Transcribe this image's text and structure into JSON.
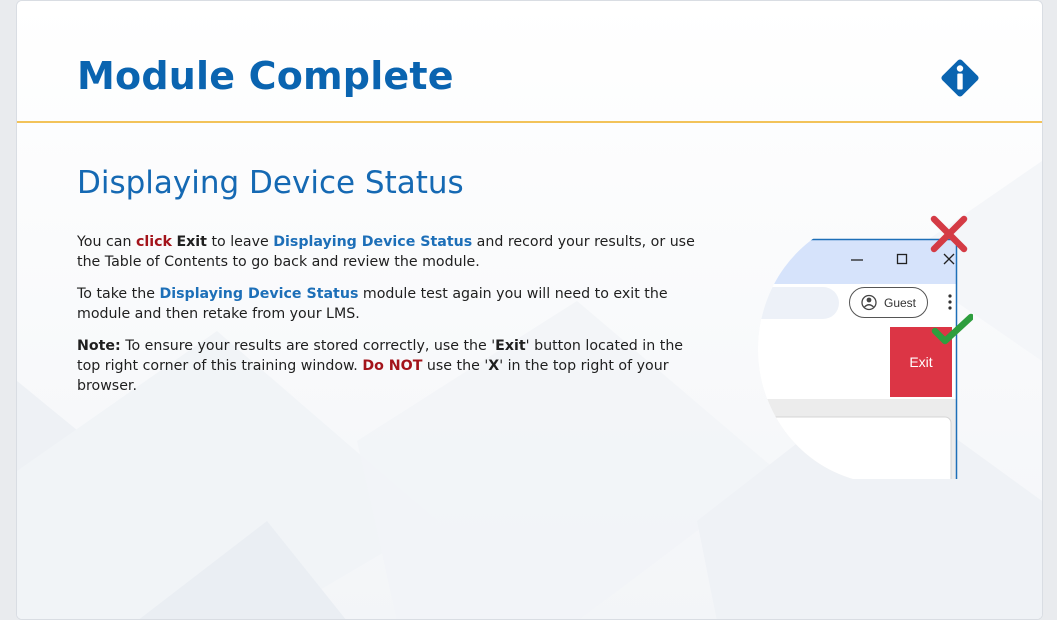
{
  "header": {
    "title": "Module Complete",
    "info_icon": "info-diamond-icon"
  },
  "main": {
    "subtitle": "Displaying Device Status",
    "p1": {
      "t1": "You can ",
      "click": "click",
      "t2": " ",
      "exit": "Exit",
      "t3": " to leave ",
      "module": "Displaying Device Status",
      "t4": " and record your results, or use the Table of Contents to go back and review the module."
    },
    "p2": {
      "t1": "To take the ",
      "module": "Displaying Device Status",
      "t2": " module test again you will need to exit the module and then retake from your LMS."
    },
    "p3": {
      "note": "Note:",
      "t1": " To ensure your results are stored correctly, use the '",
      "exit": "Exit",
      "t2": "' button located in the top right corner of this training window. ",
      "donot": "Do NOT",
      "t3": " use the '",
      "x": "X",
      "t4": "' in the top right of your browser."
    }
  },
  "illustration": {
    "guest_label": "Guest",
    "exit_label": "Exit",
    "icons": [
      "minimize-icon",
      "maximize-icon",
      "close-icon",
      "profile-icon",
      "more-vert-icon",
      "red-x-mark-icon",
      "green-check-mark-icon"
    ]
  },
  "colors": {
    "title": "#0a64b0",
    "accent_line": "#f2c35a",
    "highlight_red": "#a3131a",
    "highlight_blue": "#1d6fb8",
    "exit_button": "#dc3545",
    "check_green": "#2e9e3e"
  }
}
